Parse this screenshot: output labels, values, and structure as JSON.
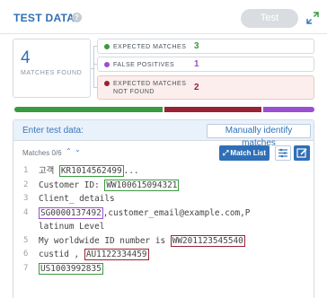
{
  "header": {
    "title": "TEST DATA",
    "help_glyph": "?",
    "test_button_label": "Test"
  },
  "summary": {
    "count": "4",
    "label": "MATCHES FOUND"
  },
  "stats": [
    {
      "label": "EXPECTED MATCHES",
      "value": "3",
      "color": "#3a9a3f"
    },
    {
      "label": "FALSE POSITIVES",
      "value": "1",
      "color": "#9a4fd0"
    },
    {
      "label": "EXPECTED MATCHES NOT FOUND",
      "value": "2",
      "color": "#9a2235"
    }
  ],
  "progress_bar": {
    "segments": [
      {
        "status": "expected",
        "fraction": 0.6,
        "color": "#3a9a3f"
      },
      {
        "status": "not_found",
        "fraction": 0.2,
        "color": "#9a2235"
      },
      {
        "status": "false_positive",
        "fraction": 0.2,
        "color": "#9a4fd0"
      }
    ]
  },
  "editor": {
    "enter_label": "Enter test data:",
    "manual_button_label": "Manually identify matches",
    "matches_nav_label": "Matches 0/6",
    "match_list_label": "Match List",
    "lines": [
      {
        "num": "1",
        "parts": [
          {
            "t": "고객 "
          },
          {
            "t": "KR1014562499",
            "hl": "g"
          },
          {
            "t": "..."
          }
        ]
      },
      {
        "num": "2",
        "parts": [
          {
            "t": "Customer ID: "
          },
          {
            "t": "WW100615094321",
            "hl": "g"
          }
        ]
      },
      {
        "num": "3",
        "parts": [
          {
            "t": "Client_ details"
          }
        ]
      },
      {
        "num": "4",
        "parts": [
          {
            "t": "SG0000137492",
            "hl": "p"
          },
          {
            "t": ",customer_email@example.com,P"
          }
        ]
      },
      {
        "num": "",
        "parts": [
          {
            "t": "latinum Level"
          }
        ]
      },
      {
        "num": "5",
        "parts": [
          {
            "t": "My worldwide ID number is "
          },
          {
            "t": "WW201123545540",
            "hl": "r"
          }
        ]
      },
      {
        "num": "6",
        "parts": [
          {
            "t": "custid , "
          },
          {
            "t": "AU1122334459",
            "hl": "r"
          }
        ]
      },
      {
        "num": "7",
        "parts": [
          {
            "t": "US1003992835",
            "hl": "g"
          }
        ]
      }
    ]
  },
  "colors": {
    "accent": "#2f6fb7",
    "expected": "#3a9a3f",
    "false_positive": "#9a4fd0",
    "not_found": "#9a2235"
  }
}
